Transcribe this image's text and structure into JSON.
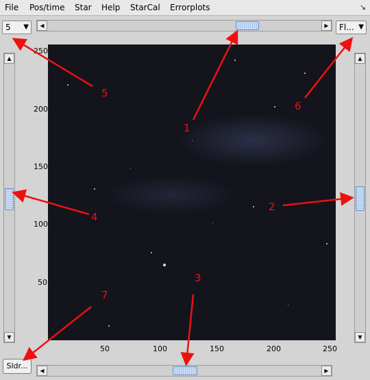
{
  "menu": {
    "items": [
      "File",
      "Pos/time",
      "Star",
      "Help",
      "StarCal",
      "Errorplots"
    ],
    "corner_icon": "restore-icon"
  },
  "controls": {
    "left_combo_value": "5",
    "right_combo_value": "Fl...",
    "bottom_button_label": "Sldr..."
  },
  "scrollbars": {
    "top": {
      "level": 0.71
    },
    "bottom": {
      "level": 0.49
    },
    "left": {
      "level": 0.49
    },
    "right": {
      "level": 0.49
    }
  },
  "plot": {
    "x_ticks": [
      "50",
      "100",
      "150",
      "200",
      "250"
    ],
    "y_ticks": [
      "250",
      "200",
      "150",
      "100",
      "50"
    ]
  },
  "annotations": [
    "1",
    "2",
    "3",
    "4",
    "5",
    "6",
    "7"
  ],
  "colors": {
    "annotation": "#ee1111",
    "scroll_thumb": "#b7cdea",
    "plot_background": "#13141c"
  }
}
